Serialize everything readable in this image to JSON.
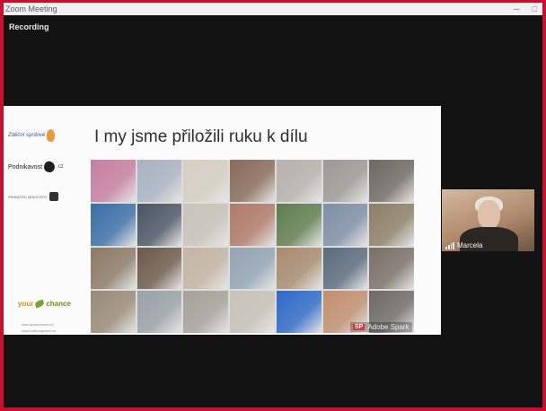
{
  "window": {
    "title": "Zoom Meeting",
    "controls": {
      "minimize": "─",
      "maximize": "□"
    }
  },
  "status": {
    "recording_label": "Recording"
  },
  "slide": {
    "title": "I my jsme přiložili ruku k dílu",
    "logos": {
      "logo1": "Zděční sprdové",
      "logo2_text": "Podnikavost",
      "logo2_suffix": ".cz",
      "logo3": "PRIMÁČEK MINISTERY",
      "logo4_your": "your",
      "logo4_chance": "chance"
    },
    "urls": [
      "www.yourchance.cz",
      "www.rodinnapraxe.cz"
    ],
    "watermark": {
      "mark": "SP",
      "text": "Adobe Spark"
    },
    "collage_colors": [
      "#c77fa1",
      "#a9b4c2",
      "#d7cfc1",
      "#8a6b5a",
      "#b8b2ad",
      "#9d9a97",
      "#6e6a62",
      "#3a6ea8",
      "#4a5563",
      "#c9c3b9",
      "#b07a68",
      "#5f7d4e",
      "#7f8fa6",
      "#8d7f66",
      "#8c7a66",
      "#6c5a4a",
      "#c5b5a3",
      "#94a5b5",
      "#a98c6f",
      "#5a6b7d",
      "#7a7067",
      "#9a8b78",
      "#9aa3a8",
      "#a7a39a",
      "#c8c2b7",
      "#2e69c9",
      "#c2906f",
      "#6f6a66"
    ]
  },
  "video_tile": {
    "participant_name": "Marcela",
    "signal_icon": "signal-bars-icon"
  }
}
